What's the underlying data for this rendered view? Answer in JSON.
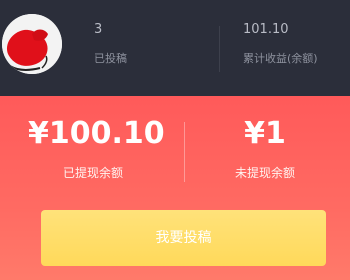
{
  "profile": {
    "avatar": "avatar-red-scribble"
  },
  "stats": {
    "posted_count": "3",
    "posted_label": "已投稿",
    "income_value": "101.10",
    "income_label": "累计收益(余额)"
  },
  "balance": {
    "withdrawn_amount": "¥100.10",
    "withdrawn_label": "已提现余额",
    "pending_amount": "¥1",
    "pending_label": "未提现余额"
  },
  "actions": {
    "submit_label": "我要投稿"
  },
  "colors": {
    "header_bg": "#2b2e3a",
    "panel_bg": "#ff5f5f",
    "button_bg": "#ffdd66"
  }
}
